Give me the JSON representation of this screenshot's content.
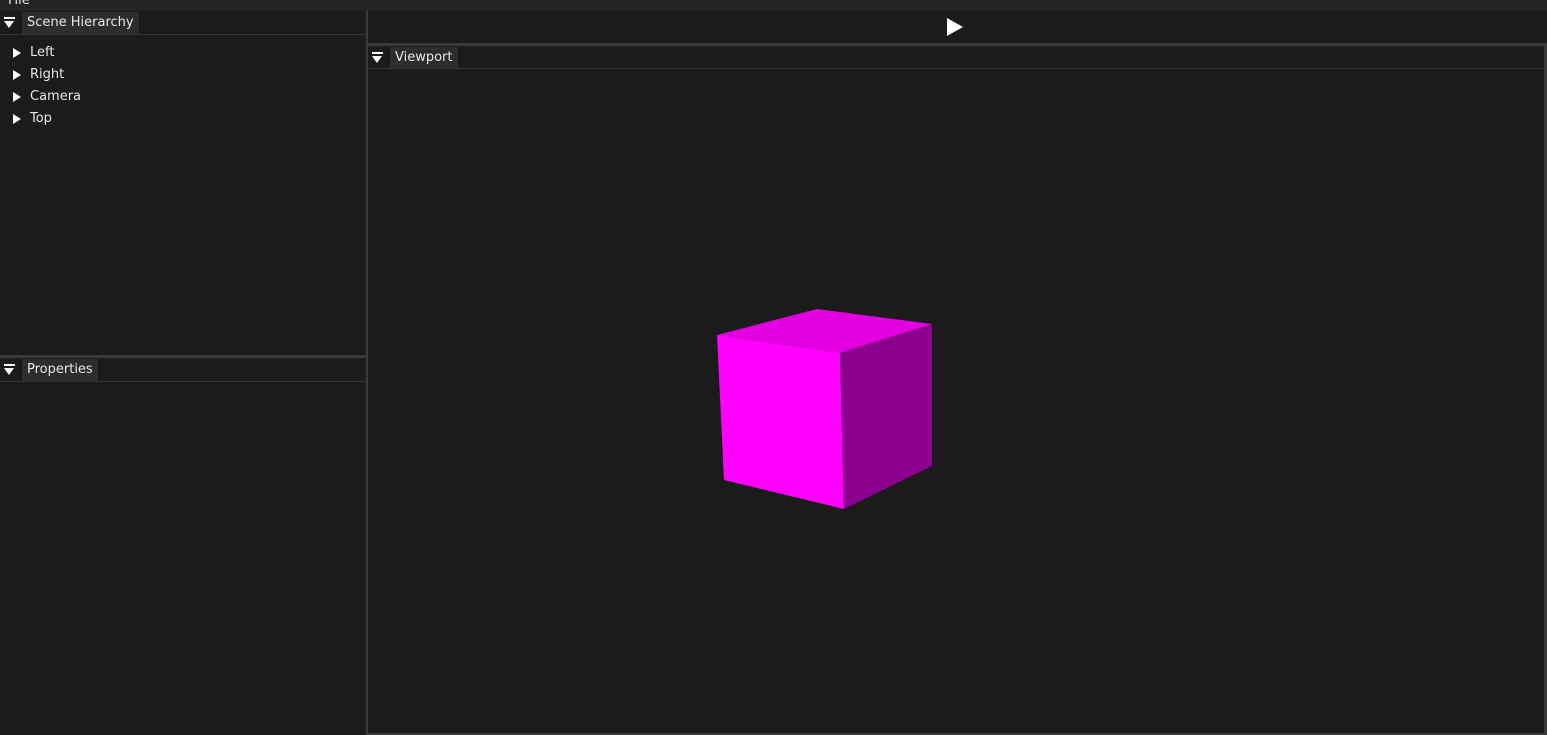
{
  "menu": {
    "items": [
      {
        "label": "File"
      }
    ]
  },
  "scene_hierarchy": {
    "title": "Scene Hierarchy",
    "items": [
      {
        "label": "Left"
      },
      {
        "label": "Right"
      },
      {
        "label": "Camera"
      },
      {
        "label": "Top"
      }
    ]
  },
  "properties": {
    "title": "Properties"
  },
  "toolbar": {
    "play_icon": "play-icon"
  },
  "viewport": {
    "title": "Viewport",
    "cube_colors": {
      "front": "#ff00ff",
      "top": "#e200e0",
      "side": "#8c0090"
    }
  },
  "colors": {
    "background": "#1b1b1c",
    "divider": "#3a3a3c",
    "tab": "#2d2d2f"
  }
}
